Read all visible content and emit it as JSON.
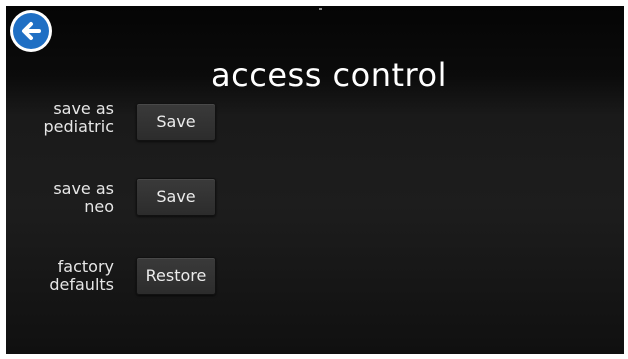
{
  "header": {
    "title": "access control",
    "back_icon": "back-arrow-icon",
    "accent_color": "#1f6fc4"
  },
  "rows": [
    {
      "label_line1": "save as",
      "label_line2": "pediatric",
      "button_label": "Save"
    },
    {
      "label_line1": "save as",
      "label_line2": "neo",
      "button_label": "Save"
    },
    {
      "label_line1": "factory",
      "label_line2": "defaults",
      "button_label": "Restore"
    }
  ]
}
